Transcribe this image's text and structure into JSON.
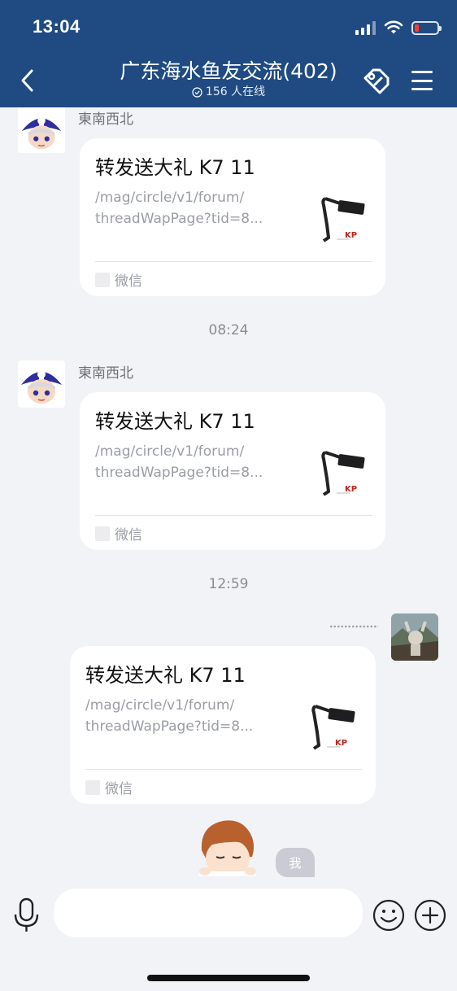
{
  "status_bar": {
    "time": "13:04"
  },
  "header": {
    "title": "广东海水鱼友交流(402)",
    "online": "156 人在线"
  },
  "messages": [
    {
      "sender": "東南西北",
      "card": {
        "title": "转发送大礼 K7 11",
        "desc_line1": "/mag/circle/v1/forum/",
        "desc_line2": "threadWapPage?tid=8...",
        "source": "微信"
      }
    },
    {
      "sender": "東南西北",
      "card": {
        "title": "转发送大礼 K7 11",
        "desc_line1": "/mag/circle/v1/forum/",
        "desc_line2": "threadWapPage?tid=8...",
        "source": "微信"
      }
    },
    {
      "sender": "",
      "card": {
        "title": "转发送大礼 K7 11",
        "desc_line1": "/mag/circle/v1/forum/",
        "desc_line2": "threadWapPage?tid=8...",
        "source": "微信"
      }
    }
  ],
  "time_separators": [
    "08:24",
    "12:59"
  ],
  "me_label": "我",
  "input": {
    "placeholder": ""
  },
  "icons": {
    "back": "chevron-left-icon",
    "tag": "tag-icon",
    "menu": "hamburger-menu-icon",
    "mic": "microphone-icon",
    "emoji": "smiley-icon",
    "plus": "plus-circle-icon"
  },
  "colors": {
    "header_bg": "#1f4b82",
    "background": "#f2f3f7",
    "battery_low": "#ff3b30"
  }
}
